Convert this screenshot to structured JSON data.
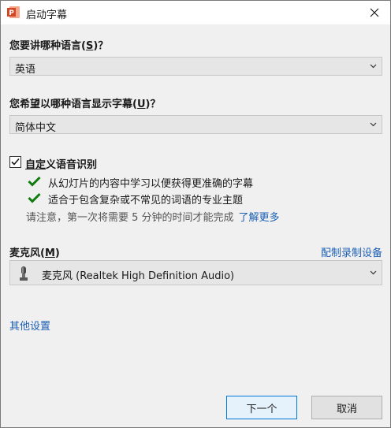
{
  "window": {
    "title": "启动字幕",
    "close_icon": "close-icon",
    "app_icon": "powerpoint-icon"
  },
  "speak_language": {
    "label_pre": "您要讲哪种语言(",
    "label_key": "S",
    "label_post": ")？",
    "selected": "英语"
  },
  "subtitle_language": {
    "label_pre": "您希望以哪种语言显示字幕(",
    "label_key": "U",
    "label_post": ")？",
    "selected": "简体中文"
  },
  "custom_recognition": {
    "checked": true,
    "label_key": "自定",
    "label_rest": "义语音识别",
    "features": [
      "从幻灯片的内容中学习以便获得更准确的字幕",
      "适合于包含复杂或不常见的词语的专业主题"
    ],
    "note": "请注意，第一次将需要 5 分钟的时间才能完成",
    "learn_more": "了解更多"
  },
  "microphone": {
    "label_pre": "麦克风(",
    "label_key": "M",
    "label_post": ")",
    "config_link": "配制录制设备",
    "selected": "麦克风 (Realtek High Definition Audio)"
  },
  "other_settings": "其他设置",
  "buttons": {
    "next": "下一个",
    "cancel": "取消"
  },
  "colors": {
    "accent": "#0078d7",
    "link": "#1b5fb3",
    "check_green": "#107c10",
    "ppt_orange": "#d24726"
  }
}
